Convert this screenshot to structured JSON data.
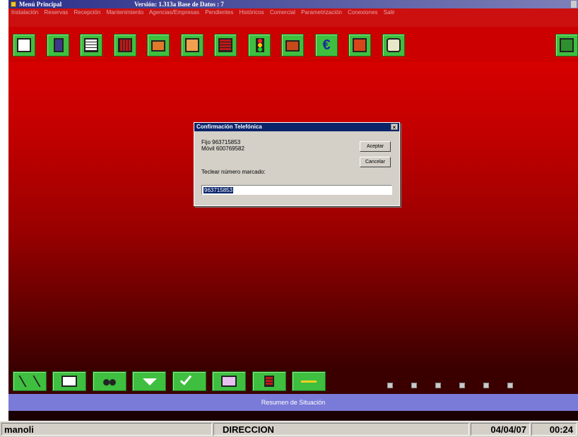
{
  "window": {
    "title": "Menú Principal",
    "version_text": "Versión: 1.313a Base de Datos : 7"
  },
  "menu": [
    "Instalación",
    "Reservas",
    "Recepción",
    "Mantenimiento",
    "Agencias/Empresas",
    "Pendientes",
    "Históricos",
    "Comercial",
    "Parametrización",
    "Conexiones",
    "Salir"
  ],
  "toolbar_icons": [
    "image-icon",
    "document-icon",
    "grid-icon",
    "calendar-grid-icon",
    "briefcase-icon",
    "notes-icon",
    "report-icon",
    "traffic-light-icon",
    "suitcase-icon",
    "euro-icon",
    "cash-register-icon",
    "telephone-icon",
    "exit-door-icon"
  ],
  "dialog": {
    "title": "Confirmación Telefónica",
    "close_glyph": "×",
    "fijo_line": "Fijo  963715853",
    "movil_line": "Móvil  600769582",
    "prompt": "Teclear número marcado:",
    "input_value": "963715853",
    "accept_label": "Aceptar",
    "cancel_label": "Cancelar"
  },
  "bottom_icons": [
    "scissors-icon",
    "envelope-icon",
    "binoculars-icon",
    "chevron-down-icon",
    "checkmark-icon",
    "printer-icon",
    "schedule-icon",
    "key-icon"
  ],
  "checkboxes": 6,
  "summary_label": "Resumen de Situación",
  "status": {
    "user": "manoli",
    "department": "DIRECCION",
    "date": "04/04/07",
    "time": "00:24"
  }
}
